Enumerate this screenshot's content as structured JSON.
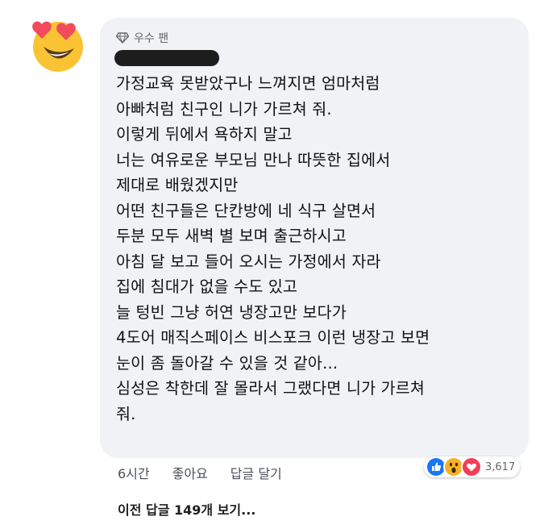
{
  "comment": {
    "badge_label": "우수 팬",
    "lines": [
      "가정교육 못받았구나 느껴지면 엄마처럼",
      "아빠처럼 친구인 니가 가르쳐 줘.",
      "이렇게 뒤에서 욕하지 말고",
      "너는 여유로운 부모님 만나 따뜻한 집에서",
      "제대로 배웠겠지만",
      "어떤 친구들은 단칸방에 네 식구 살면서",
      "두분 모두 새벽 별 보며 출근하시고",
      "아침 달 보고 들어 오시는 가정에서 자라",
      "집에 침대가 없을 수도 있고",
      "늘 텅빈 그냥 허연 냉장고만 보다가",
      "4도어 매직스페이스 비스포크 이런 냉장고 보면",
      "눈이 좀 돌아갈 수 있을 것 같아...",
      "심성은 착한데 잘 몰라서 그랬다면 니가 가르쳐",
      "줘."
    ]
  },
  "actions": {
    "time": "6시간",
    "like": "좋아요",
    "reply": "답글 달기"
  },
  "reactions": {
    "icons": [
      "like-icon",
      "wow-icon",
      "love-icon"
    ],
    "count": "3,617"
  },
  "replies": {
    "view_previous": "이전 답글 149개 보기..."
  },
  "colors": {
    "bubble_bg": "#f0f2f5",
    "like_blue": "#1877f2",
    "love_red": "#f33e58",
    "wow_yellow": "#f7b125"
  }
}
